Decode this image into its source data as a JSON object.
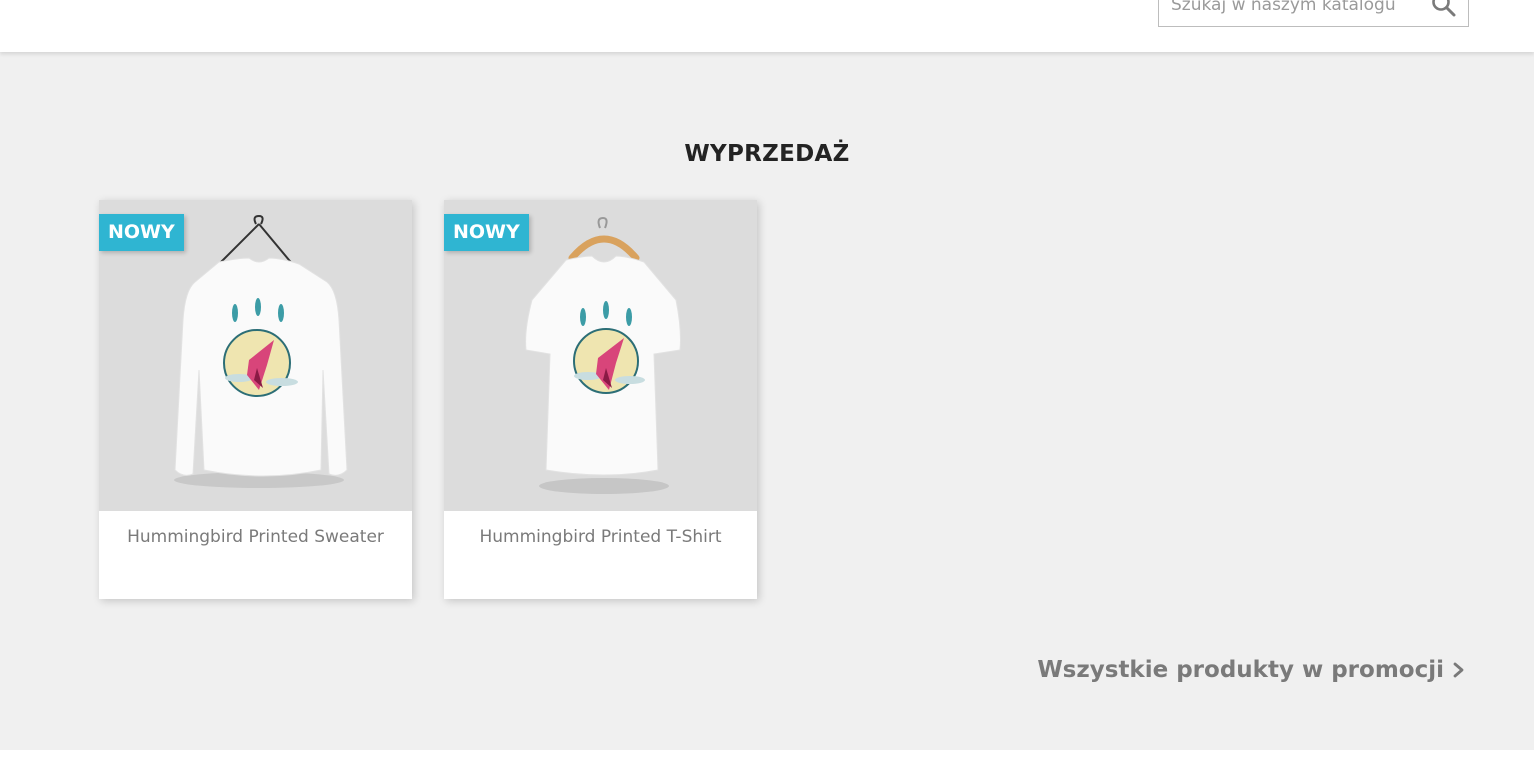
{
  "header": {
    "search": {
      "placeholder": "Szukaj w naszym katalogu",
      "button_icon": "search-icon"
    }
  },
  "section": {
    "title": "WYPRZEDAŻ",
    "products": [
      {
        "badge": "NOWY",
        "name": "Hummingbird Printed Sweater",
        "image": "long-sleeve-sweater-hummingbird"
      },
      {
        "badge": "NOWY",
        "name": "Hummingbird Printed T-Shirt",
        "image": "tshirt-hummingbird"
      }
    ],
    "all_link": {
      "label": "Wszystkie produkty w promocji",
      "icon": "chevron-right-icon"
    }
  },
  "colors": {
    "badge": "#2fb5d2",
    "page_bg": "#f0f0f0",
    "link_text": "#7a7a7a"
  }
}
